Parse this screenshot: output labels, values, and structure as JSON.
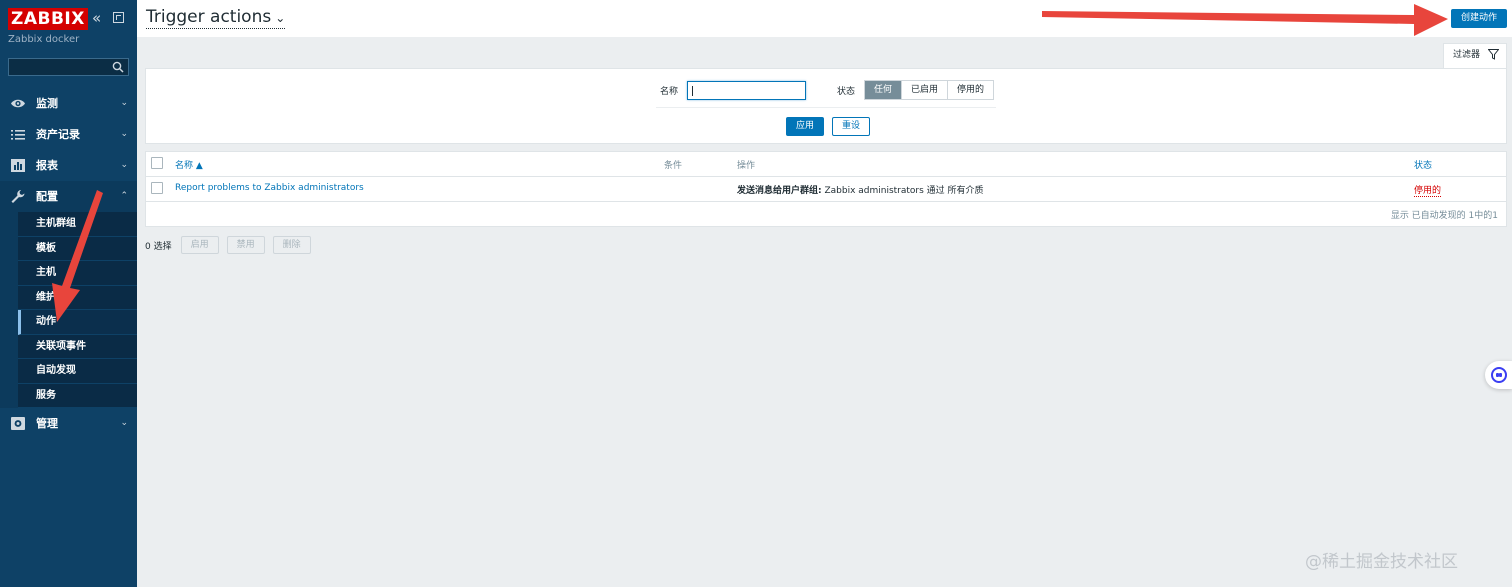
{
  "sidebar": {
    "logo": "ZABBIX",
    "server_name": "Zabbix docker",
    "collapse_icon": "«",
    "menu": [
      {
        "label": "监测",
        "icon": "eye-icon",
        "chevron": "⌄"
      },
      {
        "label": "资产记录",
        "icon": "list-icon",
        "chevron": "⌄"
      },
      {
        "label": "报表",
        "icon": "chart-icon",
        "chevron": "⌄"
      },
      {
        "label": "配置",
        "icon": "wrench-icon",
        "chevron": "⌃"
      },
      {
        "label": "管理",
        "icon": "gear-icon",
        "chevron": "⌄"
      }
    ],
    "submenu": [
      "主机群组",
      "模板",
      "主机",
      "维护",
      "动作",
      "关联项事件",
      "自动发现",
      "服务"
    ]
  },
  "header": {
    "title": "Trigger actions",
    "title_chevron": "⌄",
    "create_button": "创建动作"
  },
  "filter": {
    "tab_label": "过滤器",
    "name_label": "名称",
    "name_value": "",
    "status_label": "状态",
    "status_options": [
      "任何",
      "已启用",
      "停用的"
    ],
    "status_selected": "任何",
    "apply": "应用",
    "reset": "重设"
  },
  "table": {
    "columns": {
      "name": "名称 ▲",
      "conditions": "条件",
      "operations": "操作",
      "status": "状态"
    },
    "rows": [
      {
        "name": "Report problems to Zabbix administrators",
        "conditions": "",
        "operation_bold": "发送消息给用户群组:",
        "operation_rest": " Zabbix administrators 通过 所有介质",
        "status": "停用的"
      }
    ],
    "summary": "显示 已自动发现的 1中的1"
  },
  "mass_actions": {
    "selected": "0 选择",
    "enable": "启用",
    "disable": "禁用",
    "delete": "删除"
  },
  "colors": {
    "sidebar_bg": "#0e4166",
    "logo_bg": "#d40000",
    "accent": "#0275b8",
    "status_disabled": "#d40000",
    "annotation_arrow": "#e8453c"
  },
  "watermark": "@稀土掘金技术社区"
}
